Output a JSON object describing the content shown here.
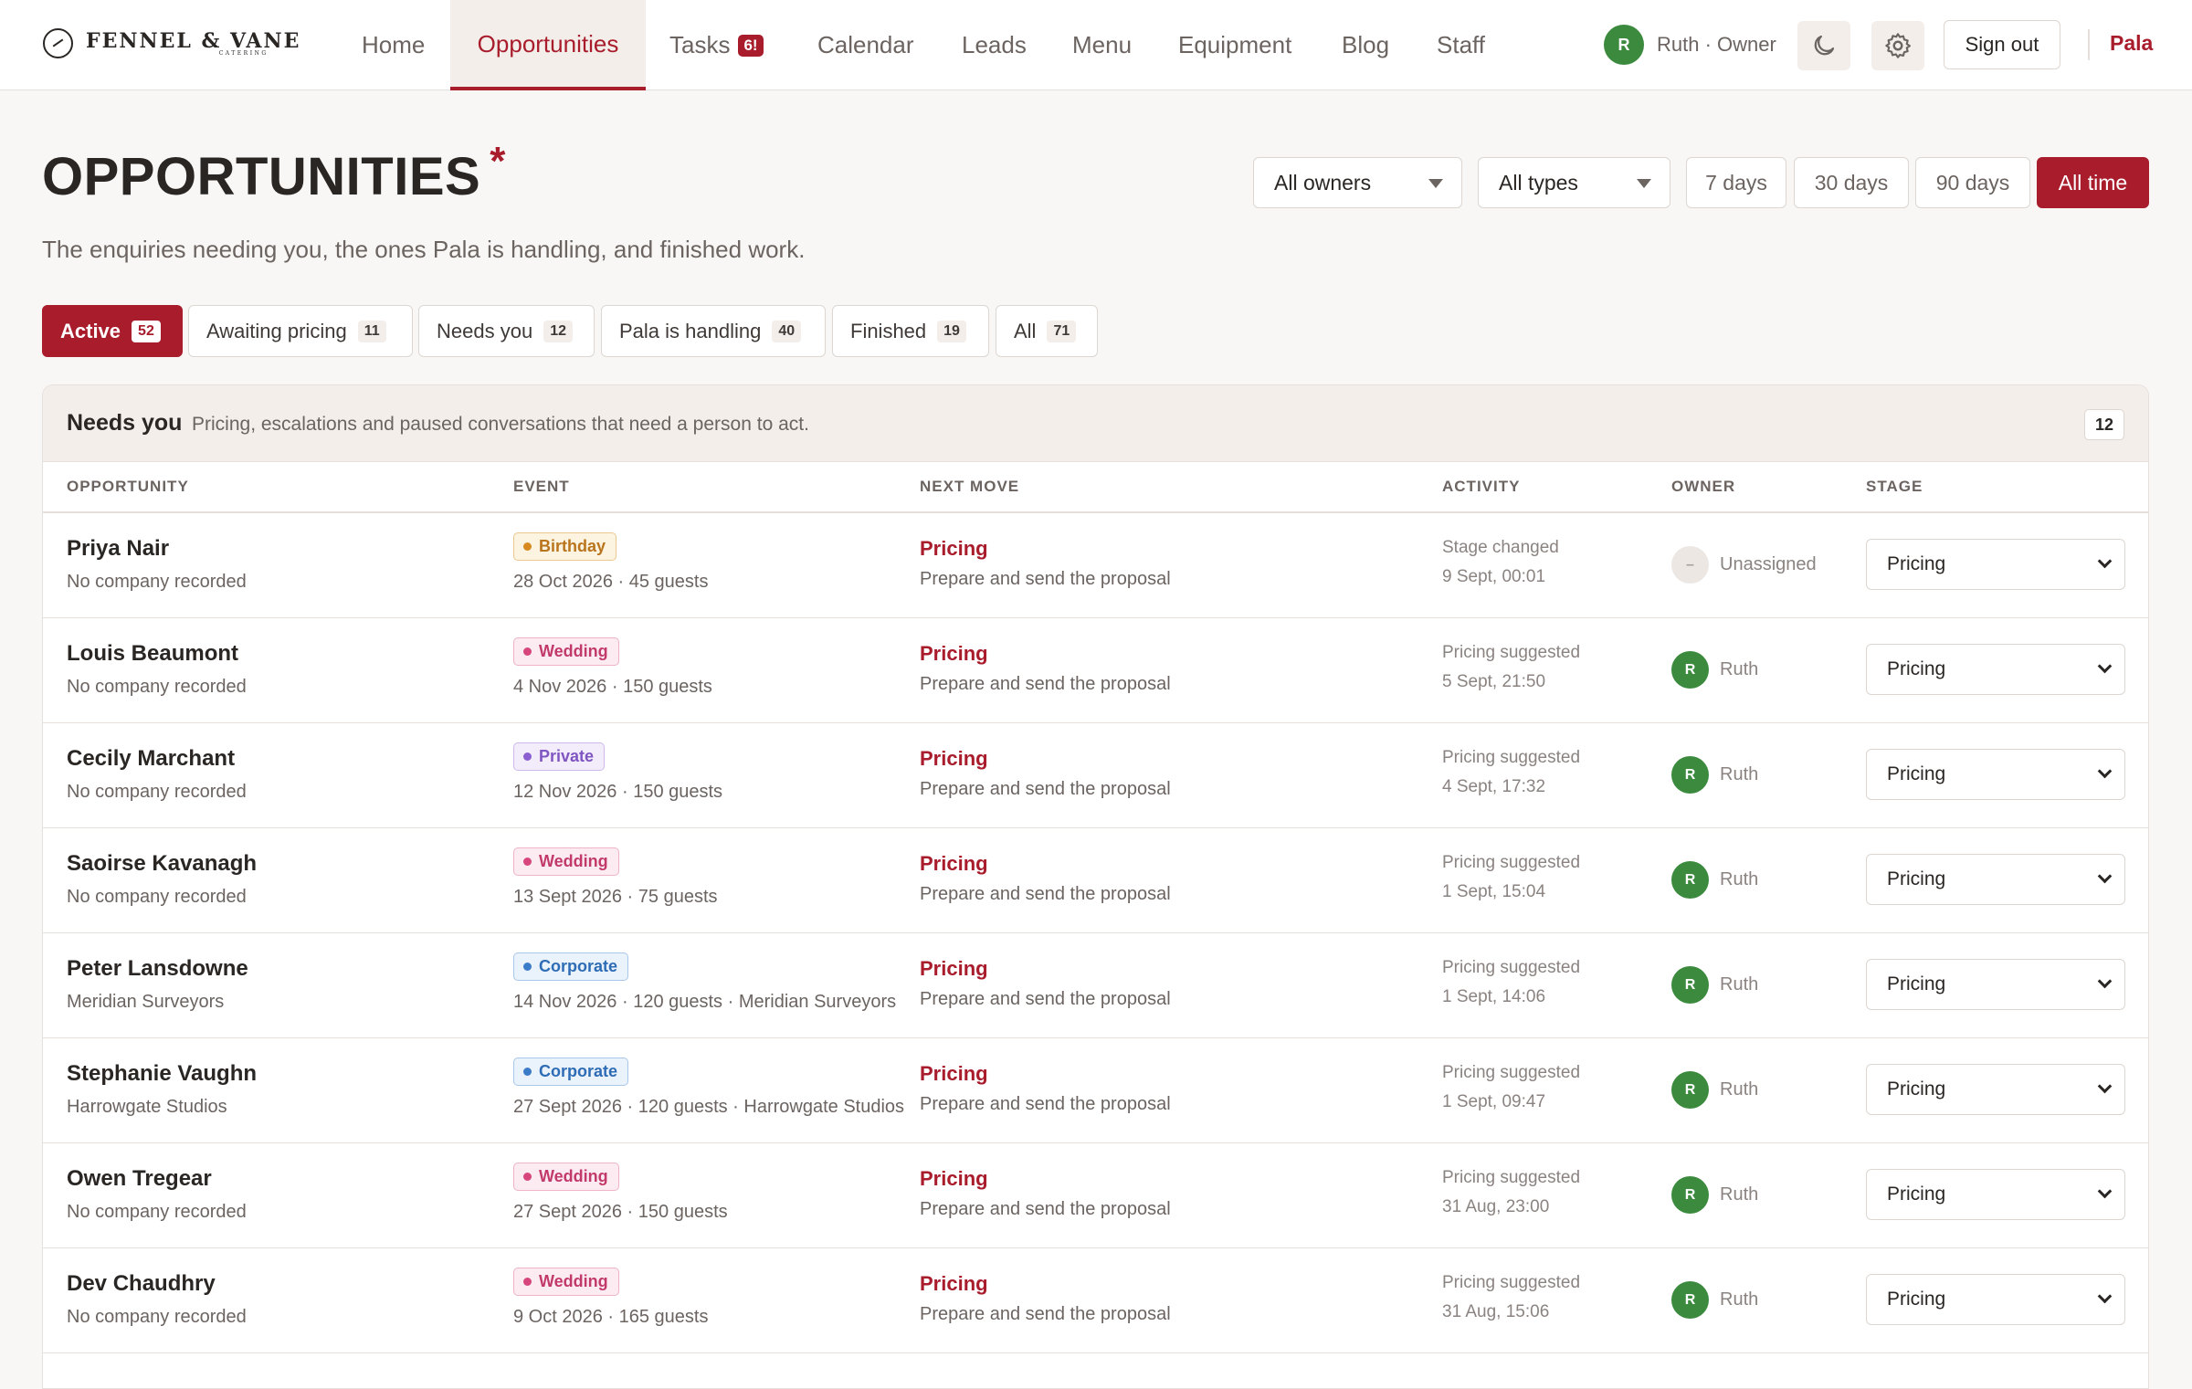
{
  "brand": {
    "name": "FENNEL & VANE",
    "sub": "CATERING"
  },
  "nav": {
    "items": [
      {
        "label": "Home"
      },
      {
        "label": "Opportunities"
      },
      {
        "label": "Tasks"
      },
      {
        "label": "Calendar"
      },
      {
        "label": "Leads"
      },
      {
        "label": "Menu"
      },
      {
        "label": "Equipment"
      },
      {
        "label": "Blog"
      },
      {
        "label": "Staff"
      }
    ],
    "tasks_badge": "6!",
    "active": "Opportunities"
  },
  "user": {
    "initial": "R",
    "label": "Ruth · Owner"
  },
  "header_actions": {
    "sign_out": "Sign out",
    "pala": "Pala"
  },
  "page": {
    "title": "OPPORTUNITIES",
    "title_mark": "*",
    "subtitle": "The enquiries needing you, the ones Pala is handling, and finished work."
  },
  "filters": {
    "owner": "All owners",
    "type": "All types",
    "ranges": [
      "7 days",
      "30 days",
      "90 days",
      "All time"
    ],
    "active_range": "All time"
  },
  "tabs": [
    {
      "label": "Active",
      "count": "52"
    },
    {
      "label": "Awaiting pricing",
      "count": "11"
    },
    {
      "label": "Needs you",
      "count": "12"
    },
    {
      "label": "Pala is handling",
      "count": "40"
    },
    {
      "label": "Finished",
      "count": "19"
    },
    {
      "label": "All",
      "count": "71"
    }
  ],
  "active_tab": "Active",
  "section": {
    "title": "Needs you",
    "description": "Pricing, escalations and paused conversations that need a person to act.",
    "count": "12"
  },
  "columns": [
    "OPPORTUNITY",
    "EVENT",
    "NEXT MOVE",
    "ACTIVITY",
    "OWNER",
    "STAGE"
  ],
  "tag_colors": {
    "Birthday": {
      "bg": "#fdf3e1",
      "border": "#e9c98e",
      "text": "#b9741c",
      "dot": "#d68a1f"
    },
    "Wedding": {
      "bg": "#fcebf1",
      "border": "#eeb3c7",
      "text": "#c13a6a",
      "dot": "#d6457b"
    },
    "Private": {
      "bg": "#f3edfb",
      "border": "#cdb9ea",
      "text": "#7f55c2",
      "dot": "#8b5fcf"
    },
    "Corporate": {
      "bg": "#eaf2fb",
      "border": "#a9c7ea",
      "text": "#2e6cb5",
      "dot": "#3b7bc8"
    }
  },
  "rows": [
    {
      "name": "Priya Nair",
      "company": "No company recorded",
      "tag": "Birthday",
      "event": "28 Oct 2026 · 45 guests",
      "next": "Pricing",
      "next_sub": "Prepare and send the proposal",
      "activity": "Stage changed",
      "activity_date": "9 Sept, 00:01",
      "owner_initial": "–",
      "owner": "Unassigned",
      "stage": "Pricing"
    },
    {
      "name": "Louis Beaumont",
      "company": "No company recorded",
      "tag": "Wedding",
      "event": "4 Nov 2026 · 150 guests",
      "next": "Pricing",
      "next_sub": "Prepare and send the proposal",
      "activity": "Pricing suggested",
      "activity_date": "5 Sept, 21:50",
      "owner_initial": "R",
      "owner": "Ruth",
      "stage": "Pricing"
    },
    {
      "name": "Cecily Marchant",
      "company": "No company recorded",
      "tag": "Private",
      "event": "12 Nov 2026 · 150 guests",
      "next": "Pricing",
      "next_sub": "Prepare and send the proposal",
      "activity": "Pricing suggested",
      "activity_date": "4 Sept, 17:32",
      "owner_initial": "R",
      "owner": "Ruth",
      "stage": "Pricing"
    },
    {
      "name": "Saoirse Kavanagh",
      "company": "No company recorded",
      "tag": "Wedding",
      "event": "13 Sept 2026 · 75 guests",
      "next": "Pricing",
      "next_sub": "Prepare and send the proposal",
      "activity": "Pricing suggested",
      "activity_date": "1 Sept, 15:04",
      "owner_initial": "R",
      "owner": "Ruth",
      "stage": "Pricing"
    },
    {
      "name": "Peter Lansdowne",
      "company": "Meridian Surveyors",
      "tag": "Corporate",
      "event": "14 Nov 2026 · 120 guests · Meridian Surveyors",
      "next": "Pricing",
      "next_sub": "Prepare and send the proposal",
      "activity": "Pricing suggested",
      "activity_date": "1 Sept, 14:06",
      "owner_initial": "R",
      "owner": "Ruth",
      "stage": "Pricing"
    },
    {
      "name": "Stephanie Vaughn",
      "company": "Harrowgate Studios",
      "tag": "Corporate",
      "event": "27 Sept 2026 · 120 guests · Harrowgate Studios",
      "next": "Pricing",
      "next_sub": "Prepare and send the proposal",
      "activity": "Pricing suggested",
      "activity_date": "1 Sept, 09:47",
      "owner_initial": "R",
      "owner": "Ruth",
      "stage": "Pricing"
    },
    {
      "name": "Owen Tregear",
      "company": "No company recorded",
      "tag": "Wedding",
      "event": "27 Sept 2026 · 150 guests",
      "next": "Pricing",
      "next_sub": "Prepare and send the proposal",
      "activity": "Pricing suggested",
      "activity_date": "31 Aug, 23:00",
      "owner_initial": "R",
      "owner": "Ruth",
      "stage": "Pricing"
    },
    {
      "name": "Dev Chaudhry",
      "company": "No company recorded",
      "tag": "Wedding",
      "event": "9 Oct 2026 · 165 guests",
      "next": "Pricing",
      "next_sub": "Prepare and send the proposal",
      "activity": "Pricing suggested",
      "activity_date": "31 Aug, 15:06",
      "owner_initial": "R",
      "owner": "Ruth",
      "stage": "Pricing"
    }
  ]
}
